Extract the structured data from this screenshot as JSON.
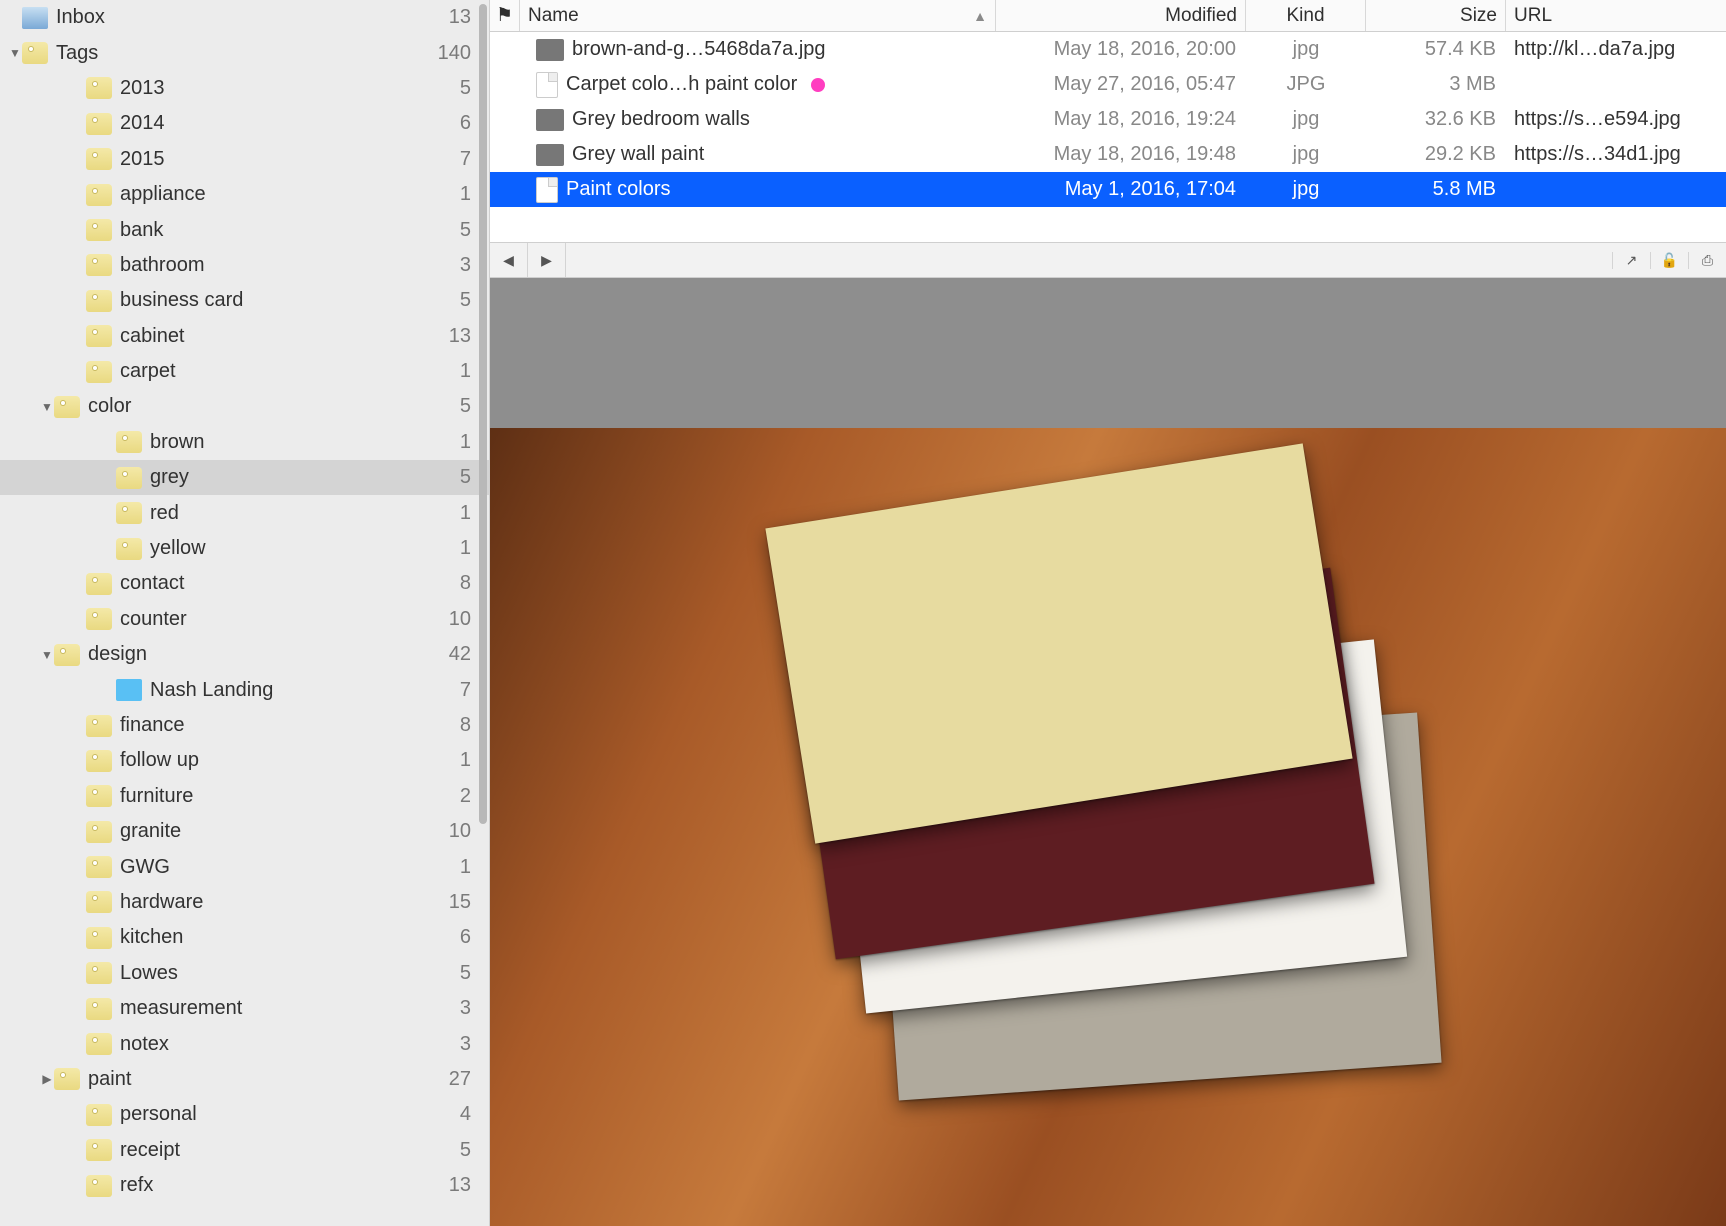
{
  "sidebar": {
    "items": [
      {
        "label": "Inbox",
        "count": 13,
        "indent": 0,
        "icon": "inbox",
        "disclosure": ""
      },
      {
        "label": "Tags",
        "count": 140,
        "indent": 0,
        "icon": "tag",
        "disclosure": "down"
      },
      {
        "label": "2013",
        "count": 5,
        "indent": 2,
        "icon": "tag",
        "disclosure": ""
      },
      {
        "label": "2014",
        "count": 6,
        "indent": 2,
        "icon": "tag",
        "disclosure": ""
      },
      {
        "label": "2015",
        "count": 7,
        "indent": 2,
        "icon": "tag",
        "disclosure": ""
      },
      {
        "label": "appliance",
        "count": 1,
        "indent": 2,
        "icon": "tag",
        "disclosure": ""
      },
      {
        "label": "bank",
        "count": 5,
        "indent": 2,
        "icon": "tag",
        "disclosure": ""
      },
      {
        "label": "bathroom",
        "count": 3,
        "indent": 2,
        "icon": "tag",
        "disclosure": ""
      },
      {
        "label": "business card",
        "count": 5,
        "indent": 2,
        "icon": "tag",
        "disclosure": ""
      },
      {
        "label": "cabinet",
        "count": 13,
        "indent": 2,
        "icon": "tag",
        "disclosure": ""
      },
      {
        "label": "carpet",
        "count": 1,
        "indent": 2,
        "icon": "tag",
        "disclosure": ""
      },
      {
        "label": "color",
        "count": 5,
        "indent": 1,
        "icon": "tag",
        "disclosure": "down"
      },
      {
        "label": "brown",
        "count": 1,
        "indent": 3,
        "icon": "tag",
        "disclosure": ""
      },
      {
        "label": "grey",
        "count": 5,
        "indent": 3,
        "icon": "tag",
        "disclosure": "",
        "selected": true
      },
      {
        "label": "red",
        "count": 1,
        "indent": 3,
        "icon": "tag",
        "disclosure": ""
      },
      {
        "label": "yellow",
        "count": 1,
        "indent": 3,
        "icon": "tag",
        "disclosure": ""
      },
      {
        "label": "contact",
        "count": 8,
        "indent": 2,
        "icon": "tag",
        "disclosure": ""
      },
      {
        "label": "counter",
        "count": 10,
        "indent": 2,
        "icon": "tag",
        "disclosure": ""
      },
      {
        "label": "design",
        "count": 42,
        "indent": 1,
        "icon": "tag",
        "disclosure": "down"
      },
      {
        "label": "Nash Landing",
        "count": 7,
        "indent": 3,
        "icon": "folder",
        "disclosure": ""
      },
      {
        "label": "finance",
        "count": 8,
        "indent": 2,
        "icon": "tag",
        "disclosure": ""
      },
      {
        "label": "follow up",
        "count": 1,
        "indent": 2,
        "icon": "tag",
        "disclosure": ""
      },
      {
        "label": "furniture",
        "count": 2,
        "indent": 2,
        "icon": "tag",
        "disclosure": ""
      },
      {
        "label": "granite",
        "count": 10,
        "indent": 2,
        "icon": "tag",
        "disclosure": ""
      },
      {
        "label": "GWG",
        "count": 1,
        "indent": 2,
        "icon": "tag",
        "disclosure": ""
      },
      {
        "label": "hardware",
        "count": 15,
        "indent": 2,
        "icon": "tag",
        "disclosure": ""
      },
      {
        "label": "kitchen",
        "count": 6,
        "indent": 2,
        "icon": "tag",
        "disclosure": ""
      },
      {
        "label": "Lowes",
        "count": 5,
        "indent": 2,
        "icon": "tag",
        "disclosure": ""
      },
      {
        "label": "measurement",
        "count": 3,
        "indent": 2,
        "icon": "tag",
        "disclosure": ""
      },
      {
        "label": "notex",
        "count": 3,
        "indent": 2,
        "icon": "tag",
        "disclosure": ""
      },
      {
        "label": "paint",
        "count": 27,
        "indent": 1,
        "icon": "tag",
        "disclosure": "right"
      },
      {
        "label": "personal",
        "count": 4,
        "indent": 2,
        "icon": "tag",
        "disclosure": ""
      },
      {
        "label": "receipt",
        "count": 5,
        "indent": 2,
        "icon": "tag",
        "disclosure": ""
      },
      {
        "label": "refx",
        "count": 13,
        "indent": 2,
        "icon": "tag",
        "disclosure": ""
      }
    ]
  },
  "columns": {
    "flag": "⚑",
    "name": "Name",
    "modified": "Modified",
    "kind": "Kind",
    "size": "Size",
    "url": "URL"
  },
  "files": [
    {
      "name": "brown-and-g…5468da7a.jpg",
      "modified": "May 18, 2016, 20:00",
      "kind": "jpg",
      "size": "57.4 KB",
      "url": "http://kl…da7a.jpg",
      "thumb": "thumb"
    },
    {
      "name": "Carpet colo…h paint color",
      "modified": "May 27, 2016, 05:47",
      "kind": "JPG",
      "size": "3 MB",
      "url": "",
      "thumb": "doc",
      "dot": true
    },
    {
      "name": "Grey bedroom walls",
      "modified": "May 18, 2016, 19:24",
      "kind": "jpg",
      "size": "32.6 KB",
      "url": "https://s…e594.jpg",
      "thumb": "thumb"
    },
    {
      "name": "Grey wall paint",
      "modified": "May 18, 2016, 19:48",
      "kind": "jpg",
      "size": "29.2 KB",
      "url": "https://s…34d1.jpg",
      "thumb": "thumb"
    },
    {
      "name": "Paint colors",
      "modified": "May 1, 2016, 17:04",
      "kind": "jpg",
      "size": "5.8 MB",
      "url": "",
      "thumb": "doc",
      "selected": true
    }
  ],
  "toolbar": {
    "back": "◀",
    "forward": "▶",
    "share": "↗",
    "lock": "🔓",
    "print": "⎙"
  }
}
